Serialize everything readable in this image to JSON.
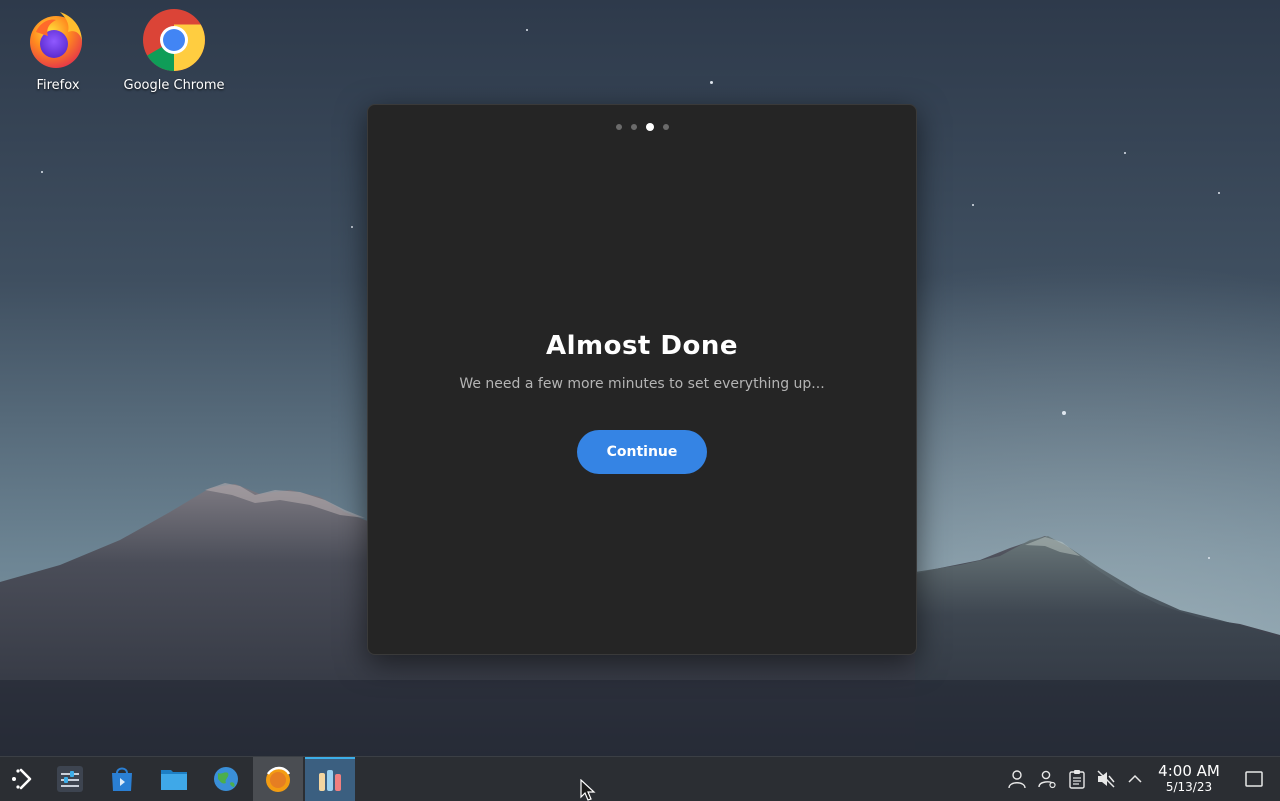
{
  "desktop": {
    "icons": [
      {
        "label": "Firefox",
        "icon": "firefox-icon"
      },
      {
        "label": "Google Chrome",
        "icon": "chrome-icon"
      }
    ]
  },
  "dialog": {
    "title": "Almost Done",
    "subtitle": "We need a few more minutes to set everything up...",
    "continue_label": "Continue",
    "page_indicator": {
      "total": 4,
      "active": 3
    }
  },
  "taskbar": {
    "apps": [
      {
        "icon": "application-launcher-icon"
      },
      {
        "icon": "system-settings-sliders-icon"
      },
      {
        "icon": "discover-store-icon"
      },
      {
        "icon": "file-manager-icon"
      },
      {
        "icon": "globe-settings-icon"
      },
      {
        "icon": "orange-app-icon"
      },
      {
        "icon": "welcome-center-icon"
      }
    ],
    "tray": [
      {
        "icon": "user-icon"
      },
      {
        "icon": "user-switch-icon"
      },
      {
        "icon": "clipboard-icon"
      },
      {
        "icon": "volume-muted-icon"
      },
      {
        "icon": "expand-tray-chevron-icon"
      }
    ],
    "clock": {
      "time": "4:00 AM",
      "date": "5/13/23"
    },
    "show_desktop_icon": "show-desktop-icon"
  },
  "colors": {
    "accent": "#3584e4",
    "dialog_bg": "#252525",
    "taskbar_bg": "#2b2e33"
  }
}
